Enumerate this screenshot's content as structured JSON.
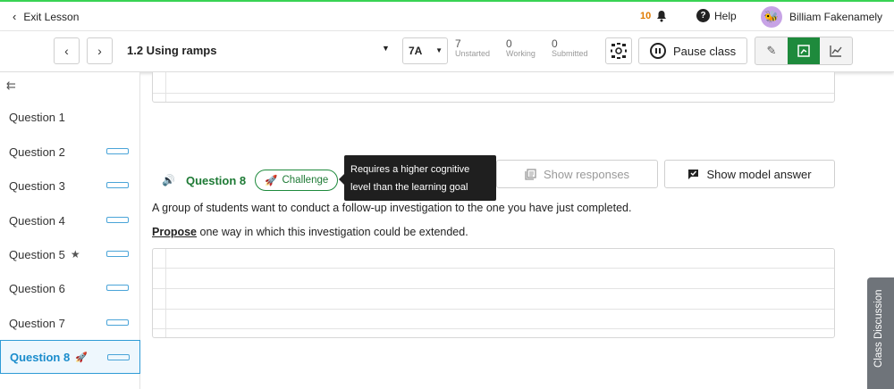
{
  "topbar": {
    "exit_label": "Exit Lesson",
    "notification_count": "10",
    "help_label": "Help",
    "user_name": "Billiam Fakenamely"
  },
  "toolbar": {
    "lesson_title": "1.2 Using ramps",
    "class_name": "7A",
    "stats": [
      {
        "value": "7",
        "label": "Unstarted"
      },
      {
        "value": "0",
        "label": "Working"
      },
      {
        "value": "0",
        "label": "Submitted"
      }
    ],
    "pause_label": "Pause class",
    "active_view": "present"
  },
  "sidebar": {
    "questions": [
      {
        "label": "Question 1",
        "has_bar": false,
        "star": false,
        "active": false
      },
      {
        "label": "Question 2",
        "has_bar": true,
        "star": false,
        "active": false
      },
      {
        "label": "Question 3",
        "has_bar": true,
        "star": false,
        "active": false
      },
      {
        "label": "Question 4",
        "has_bar": true,
        "star": false,
        "active": false
      },
      {
        "label": "Question 5",
        "has_bar": true,
        "star": true,
        "active": false
      },
      {
        "label": "Question 6",
        "has_bar": true,
        "star": false,
        "active": false
      },
      {
        "label": "Question 7",
        "has_bar": true,
        "star": false,
        "active": false
      },
      {
        "label": "Question 8",
        "has_bar": true,
        "star": false,
        "active": true,
        "rocket": true
      }
    ]
  },
  "question": {
    "title": "Question 8",
    "badge": "Challenge",
    "tooltip": "Requires a higher cognitive level than the learning goal",
    "show_responses_label": "Show responses",
    "show_model_answer_label": "Show model answer",
    "prompt_line1": "A group of students want to conduct a follow-up investigation to the one you have just completed.",
    "prompt_keyword": "Propose",
    "prompt_line2_rest": " one way in which this investigation could be extended."
  },
  "discussion_tab": {
    "label": "Class Discussion"
  },
  "colors": {
    "accent_green": "#1e8a3c",
    "active_blue": "#1a8ccc",
    "notification_orange": "#e07b00",
    "top_border": "#39d353"
  }
}
